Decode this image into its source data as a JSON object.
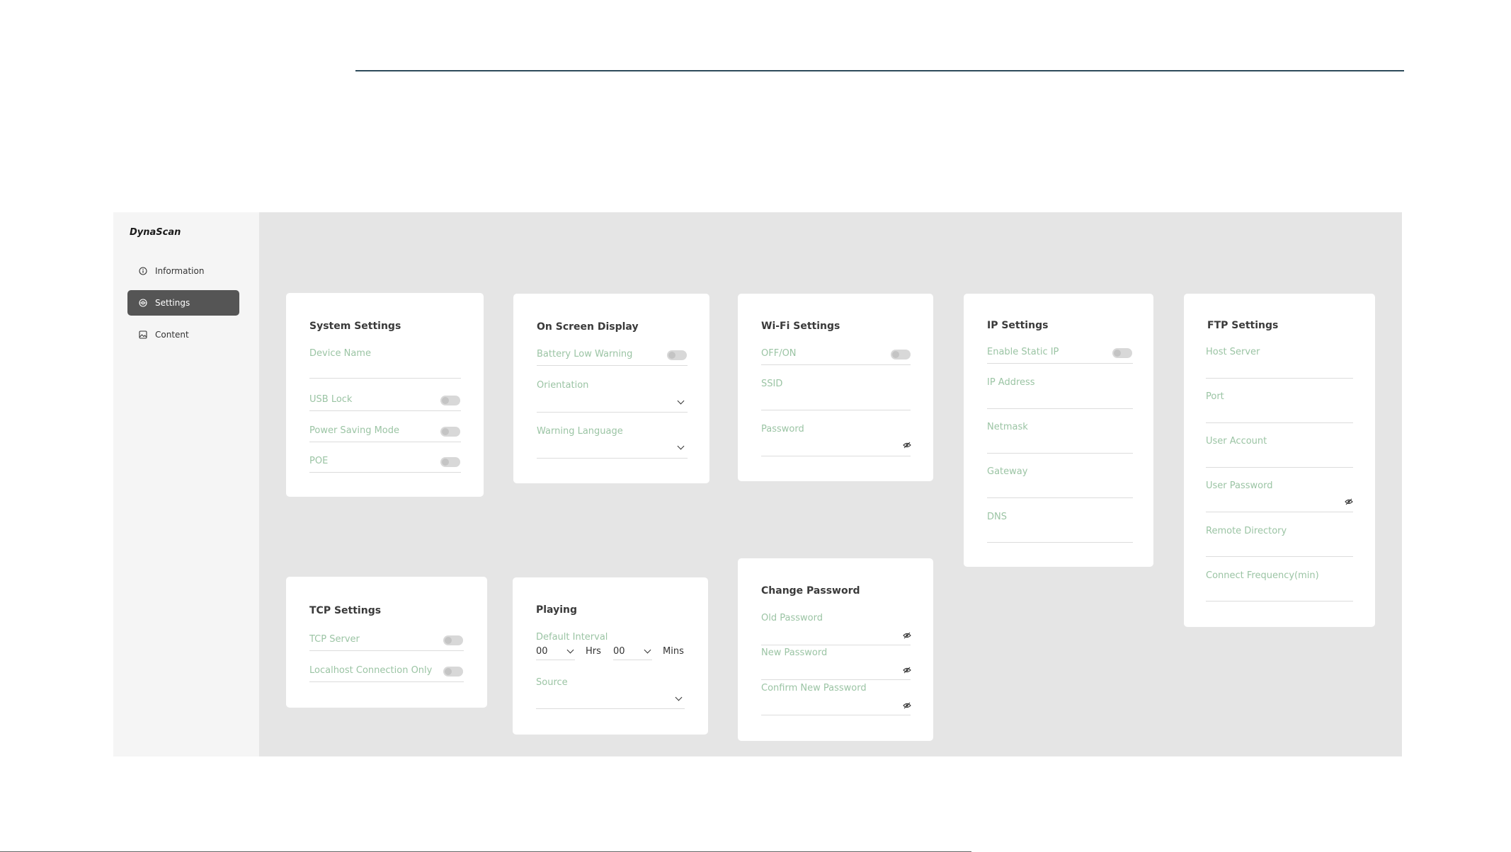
{
  "sidebar": {
    "brand": "DynaScan",
    "items": [
      {
        "label": "Information",
        "icon": "info-icon",
        "active": false
      },
      {
        "label": "Settings",
        "icon": "settings-icon",
        "active": true
      },
      {
        "label": "Content",
        "icon": "image-icon",
        "active": false
      }
    ]
  },
  "system": {
    "title": "System Settings",
    "device_name": "Device Name",
    "usb_lock": "USB Lock",
    "power_saving": "Power Saving Mode",
    "poe": "POE"
  },
  "osd": {
    "title": "On Screen Display",
    "battery_low": "Battery Low Warning",
    "orientation": "Orientation",
    "warning_language": "Warning Language"
  },
  "wifi": {
    "title": "Wi-Fi Settings",
    "offon": "OFF/ON",
    "ssid": "SSID",
    "password": "Password"
  },
  "ip": {
    "title": "IP Settings",
    "static_ip": "Enable Static IP",
    "address": "IP Address",
    "netmask": "Netmask",
    "gateway": "Gateway",
    "dns": "DNS"
  },
  "ftp": {
    "title": "FTP Settings",
    "host": "Host Server",
    "port": "Port",
    "user_account": "User Account",
    "user_password": "User Password",
    "remote_dir": "Remote Directory",
    "connect_freq": "Connect Frequency(min)"
  },
  "tcp": {
    "title": "TCP Settings",
    "server": "TCP Server",
    "localhost": "Localhost Connection Only"
  },
  "playing": {
    "title": "Playing",
    "default_interval": "Default Interval",
    "hrs_value": "00",
    "hrs_label": "Hrs",
    "mins_value": "00",
    "mins_label": "Mins",
    "source": "Source"
  },
  "change_password": {
    "title": "Change Password",
    "old": "Old Password",
    "new": "New Password",
    "confirm": "Confirm New Password"
  },
  "colors": {
    "label": "#9bc4a4",
    "active_nav": "#555555",
    "panel_bg": "#e5e5e5",
    "accent_line": "#2d4a5a"
  }
}
